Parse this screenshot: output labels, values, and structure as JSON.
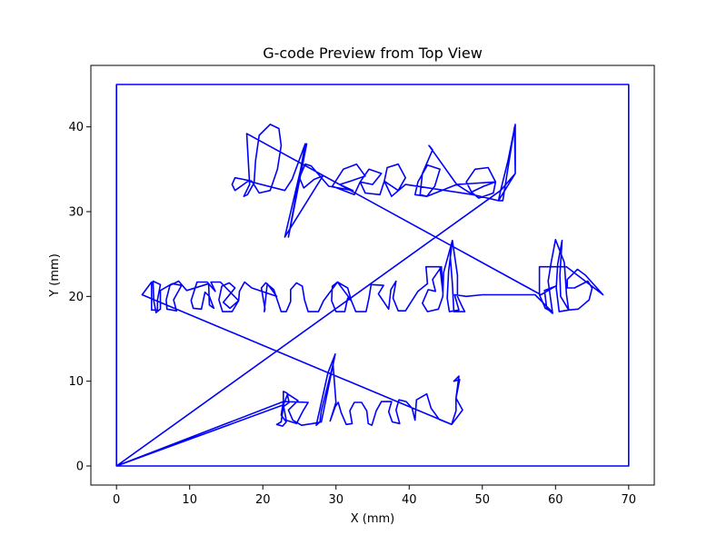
{
  "chart_data": {
    "type": "line",
    "title": "G-code Preview from Top View",
    "xlabel": "X (mm)",
    "ylabel": "Y (mm)",
    "xlim": [
      -3.5,
      73.5
    ],
    "ylim": [
      -2.25,
      47.25
    ],
    "xticks": [
      0,
      10,
      20,
      30,
      40,
      50,
      60,
      70
    ],
    "yticks": [
      0,
      10,
      20,
      30,
      40
    ],
    "grid": false,
    "line_color": "#0000ff",
    "series": [
      {
        "points": [
          [
            0,
            0
          ],
          [
            70,
            0
          ],
          [
            70,
            45
          ],
          [
            0,
            45
          ],
          [
            0,
            0
          ],
          [
            52.5,
            32.5
          ],
          [
            54.5,
            34.5
          ],
          [
            54.5,
            40.3
          ],
          [
            53.5,
            36
          ],
          [
            52.5,
            32.5
          ],
          [
            52.2,
            31.3
          ],
          [
            52.8,
            31.3
          ],
          [
            54.4,
            40
          ],
          [
            54.5,
            34.5
          ],
          [
            52.2,
            31.3
          ],
          [
            48.7,
            32
          ],
          [
            47.8,
            33.5
          ],
          [
            49,
            35
          ],
          [
            50.8,
            35.2
          ],
          [
            51.8,
            33.5
          ],
          [
            51.5,
            32.2
          ],
          [
            49.5,
            31.6
          ],
          [
            48.5,
            32.3
          ],
          [
            50.2,
            33
          ],
          [
            51.8,
            33.5
          ],
          [
            46.5,
            33.2
          ],
          [
            42.7,
            37.8
          ],
          [
            43.2,
            37.3
          ],
          [
            41.8,
            34.5
          ],
          [
            41.5,
            32
          ],
          [
            42.4,
            31.8
          ],
          [
            43.5,
            33
          ],
          [
            44.2,
            35
          ],
          [
            42.5,
            35.5
          ],
          [
            41.2,
            33.5
          ],
          [
            40.8,
            32
          ],
          [
            42.4,
            31.8
          ],
          [
            46.5,
            33.2
          ],
          [
            48.7,
            32
          ],
          [
            39.5,
            33.2
          ],
          [
            37.6,
            31.8
          ],
          [
            36.6,
            33.6
          ],
          [
            37,
            35.2
          ],
          [
            38.5,
            35.6
          ],
          [
            39.5,
            34
          ],
          [
            38.5,
            32.5
          ],
          [
            36.6,
            33.6
          ],
          [
            36,
            32
          ],
          [
            34,
            32.2
          ],
          [
            33.3,
            33.5
          ],
          [
            34.5,
            35
          ],
          [
            36.2,
            34.5
          ],
          [
            35,
            33.2
          ],
          [
            33.3,
            33.5
          ],
          [
            32.5,
            32
          ],
          [
            29.5,
            33
          ],
          [
            31,
            35
          ],
          [
            32.8,
            35.6
          ],
          [
            34,
            34.2
          ],
          [
            32,
            33.6
          ],
          [
            30.5,
            33.2
          ],
          [
            32.3,
            32.5
          ],
          [
            29,
            33
          ],
          [
            26.6,
            35.4
          ],
          [
            25.8,
            35.6
          ],
          [
            25,
            34
          ],
          [
            25.6,
            32.8
          ],
          [
            27,
            33.8
          ],
          [
            28.2,
            34.2
          ],
          [
            23,
            27
          ],
          [
            26,
            38
          ],
          [
            23.5,
            27
          ],
          [
            25.8,
            38
          ],
          [
            24,
            33.8
          ],
          [
            23,
            32.5
          ],
          [
            18,
            33.6
          ],
          [
            16.2,
            32.5
          ],
          [
            15.8,
            33.2
          ],
          [
            16.2,
            34
          ],
          [
            18.5,
            33.6
          ],
          [
            19.5,
            32.2
          ],
          [
            21,
            32.5
          ],
          [
            22,
            35
          ],
          [
            22.5,
            37.8
          ],
          [
            22.2,
            39.8
          ],
          [
            21,
            40.3
          ],
          [
            19.5,
            39
          ],
          [
            19,
            36
          ],
          [
            18.8,
            33.4
          ],
          [
            17.9,
            32
          ],
          [
            17.4,
            31.8
          ],
          [
            18.2,
            33.2
          ],
          [
            17.8,
            39.2
          ],
          [
            58,
            20.2
          ],
          [
            60,
            21.2
          ],
          [
            58.5,
            20.7
          ],
          [
            58.8,
            18.6
          ],
          [
            59.6,
            18
          ],
          [
            59,
            21.8
          ],
          [
            59.4,
            24
          ],
          [
            60,
            26.7
          ],
          [
            61.2,
            24
          ],
          [
            61.5,
            20.2
          ],
          [
            61.8,
            18.4
          ],
          [
            60.5,
            18.2
          ],
          [
            60.1,
            21
          ],
          [
            60.3,
            23.8
          ],
          [
            60.9,
            26.6
          ],
          [
            60.6,
            22.5
          ],
          [
            60.7,
            20
          ],
          [
            61.8,
            18.4
          ],
          [
            63.1,
            18.5
          ],
          [
            64.6,
            19.6
          ],
          [
            65,
            21
          ],
          [
            64.4,
            21.8
          ],
          [
            62.6,
            21
          ],
          [
            61.6,
            21
          ],
          [
            61.6,
            22
          ],
          [
            63,
            23.2
          ],
          [
            64.1,
            22.5
          ],
          [
            66.5,
            20.2
          ],
          [
            61.5,
            23.5
          ],
          [
            57.8,
            23.5
          ],
          [
            57.8,
            20.2
          ],
          [
            58.6,
            18.6
          ],
          [
            59.5,
            18.2
          ],
          [
            57.2,
            20.2
          ],
          [
            50,
            20.2
          ],
          [
            47.8,
            20
          ],
          [
            46.2,
            20.2
          ],
          [
            46.8,
            18.4
          ],
          [
            45.5,
            18.2
          ],
          [
            45.2,
            19.8
          ],
          [
            45.4,
            23
          ],
          [
            45.9,
            26.6
          ],
          [
            46.6,
            22.5
          ],
          [
            46.6,
            20
          ],
          [
            47.3,
            18.7
          ],
          [
            47.6,
            18.2
          ],
          [
            46.1,
            18.2
          ],
          [
            45.9,
            21.5
          ],
          [
            45.6,
            24.8
          ],
          [
            45.9,
            26.6
          ],
          [
            44.7,
            22.8
          ],
          [
            44.6,
            20
          ],
          [
            44,
            18.5
          ],
          [
            42.5,
            18.2
          ],
          [
            41.8,
            19.2
          ],
          [
            42.6,
            20.8
          ],
          [
            43.6,
            20.6
          ],
          [
            43.2,
            22
          ],
          [
            44.4,
            23.5
          ],
          [
            44.6,
            20.5
          ],
          [
            44.2,
            23.5
          ],
          [
            42.3,
            23.5
          ],
          [
            42.5,
            21.5
          ],
          [
            41.2,
            20.6
          ],
          [
            39.5,
            18.3
          ],
          [
            38.5,
            18.3
          ],
          [
            37.8,
            19.8
          ],
          [
            38.2,
            21.8
          ],
          [
            37.5,
            20.8
          ],
          [
            37.2,
            18.5
          ],
          [
            35.8,
            20.3
          ],
          [
            36.5,
            21.3
          ],
          [
            34.8,
            21.4
          ],
          [
            34.5,
            19.8
          ],
          [
            34.1,
            18.2
          ],
          [
            32.7,
            18.2
          ],
          [
            32.1,
            19.5
          ],
          [
            31.6,
            21
          ],
          [
            30.2,
            21.7
          ],
          [
            29.5,
            21.2
          ],
          [
            29.4,
            19.5
          ],
          [
            30,
            18.2
          ],
          [
            31.2,
            18.2
          ],
          [
            31.6,
            19.8
          ],
          [
            32.1,
            19.5
          ],
          [
            30.2,
            21.7
          ],
          [
            28.3,
            19.5
          ],
          [
            27.6,
            18.2
          ],
          [
            26.2,
            18.2
          ],
          [
            25.7,
            19.6
          ],
          [
            25.4,
            21.2
          ],
          [
            24.6,
            21.6
          ],
          [
            23.8,
            20.8
          ],
          [
            23.8,
            19.4
          ],
          [
            23.2,
            18.2
          ],
          [
            22.5,
            18.2
          ],
          [
            21.5,
            20.8
          ],
          [
            20.4,
            21.6
          ],
          [
            19.8,
            21
          ],
          [
            20.3,
            18.5
          ],
          [
            20.2,
            18.2
          ],
          [
            20.6,
            21.5
          ],
          [
            21.9,
            20
          ],
          [
            18.5,
            21
          ],
          [
            17.5,
            21.7
          ],
          [
            16.8,
            20.6
          ],
          [
            16.7,
            19.5
          ],
          [
            15.8,
            18.2
          ],
          [
            14.5,
            18.2
          ],
          [
            14,
            19.6
          ],
          [
            14.4,
            21.2
          ],
          [
            15.4,
            21.6
          ],
          [
            16.2,
            21
          ],
          [
            14.6,
            19.3
          ],
          [
            15.5,
            18.6
          ],
          [
            16.7,
            19.5
          ],
          [
            14.2,
            21.7
          ],
          [
            12.9,
            21.7
          ],
          [
            13.5,
            20.6
          ],
          [
            12.4,
            21.7
          ],
          [
            11,
            21.7
          ],
          [
            10.2,
            19.5
          ],
          [
            10.5,
            18.6
          ],
          [
            11.6,
            18.5
          ],
          [
            12.1,
            20.5
          ],
          [
            12.7,
            20
          ],
          [
            13.3,
            18.6
          ],
          [
            12.7,
            19
          ],
          [
            12.6,
            21.5
          ],
          [
            9.6,
            20.7
          ],
          [
            8.5,
            21.8
          ],
          [
            7.3,
            21.3
          ],
          [
            6.8,
            19.6
          ],
          [
            6.9,
            18.5
          ],
          [
            8.2,
            18.3
          ],
          [
            7.8,
            19.6
          ],
          [
            8.9,
            21.3
          ],
          [
            7.6,
            21.5
          ],
          [
            6,
            20.7
          ],
          [
            6,
            18.5
          ],
          [
            5.4,
            18.1
          ],
          [
            5.1,
            19.5
          ],
          [
            5,
            21.8
          ],
          [
            6,
            21.4
          ],
          [
            5.6,
            19.6
          ],
          [
            5.6,
            18.4
          ],
          [
            4.8,
            18.4
          ],
          [
            4.8,
            21.7
          ],
          [
            3.5,
            20.2
          ],
          [
            45.8,
            4.9
          ],
          [
            47.3,
            6.6
          ],
          [
            46.4,
            8
          ],
          [
            46.8,
            10.6
          ],
          [
            46.1,
            10
          ],
          [
            46.9,
            10.2
          ],
          [
            46.4,
            8
          ],
          [
            46.4,
            6.5
          ],
          [
            45.8,
            4.9
          ],
          [
            44.1,
            5.5
          ],
          [
            43,
            6.8
          ],
          [
            42.4,
            8.5
          ],
          [
            41,
            7.8
          ],
          [
            40.8,
            5.4
          ],
          [
            40.4,
            6.8
          ],
          [
            39.6,
            7.6
          ],
          [
            38.6,
            7.8
          ],
          [
            38.2,
            6.6
          ],
          [
            38.7,
            5
          ],
          [
            37.7,
            5.2
          ],
          [
            37.2,
            6.4
          ],
          [
            37.6,
            7.6
          ],
          [
            36.2,
            7.6
          ],
          [
            35.5,
            6.5
          ],
          [
            34.9,
            4.8
          ],
          [
            34.4,
            5
          ],
          [
            34.2,
            6.5
          ],
          [
            33.5,
            7.5
          ],
          [
            32.5,
            7.5
          ],
          [
            31.9,
            6.5
          ],
          [
            32.2,
            5
          ],
          [
            31.4,
            4.9
          ],
          [
            30.7,
            6.3
          ],
          [
            30.3,
            7.5
          ],
          [
            29.9,
            7
          ],
          [
            29.2,
            5.3
          ],
          [
            30,
            7.5
          ],
          [
            29.6,
            12
          ],
          [
            28,
            6.5
          ],
          [
            27.8,
            5.2
          ],
          [
            27.3,
            4.8
          ],
          [
            28.9,
            11
          ],
          [
            29.9,
            13.2
          ],
          [
            28,
            5.2
          ],
          [
            26.8,
            5
          ],
          [
            25.3,
            4.8
          ],
          [
            24.1,
            5.4
          ],
          [
            23.5,
            6.6
          ],
          [
            24.8,
            7.7
          ],
          [
            23.4,
            8.5
          ],
          [
            22.8,
            7.2
          ],
          [
            23.2,
            5.4
          ],
          [
            24.6,
            5
          ],
          [
            25.5,
            6.5
          ],
          [
            26.2,
            7.5
          ],
          [
            22.8,
            7.6
          ],
          [
            22.8,
            8.8
          ],
          [
            23.3,
            8.6
          ],
          [
            23.6,
            7.5
          ],
          [
            22.8,
            7
          ],
          [
            22.5,
            5.2
          ],
          [
            21.9,
            4.9
          ],
          [
            22.7,
            4.7
          ],
          [
            23.2,
            5.2
          ],
          [
            22.5,
            6
          ],
          [
            22.8,
            7.6
          ],
          [
            0,
            0
          ],
          [
            22.8,
            7.2
          ]
        ]
      }
    ]
  }
}
